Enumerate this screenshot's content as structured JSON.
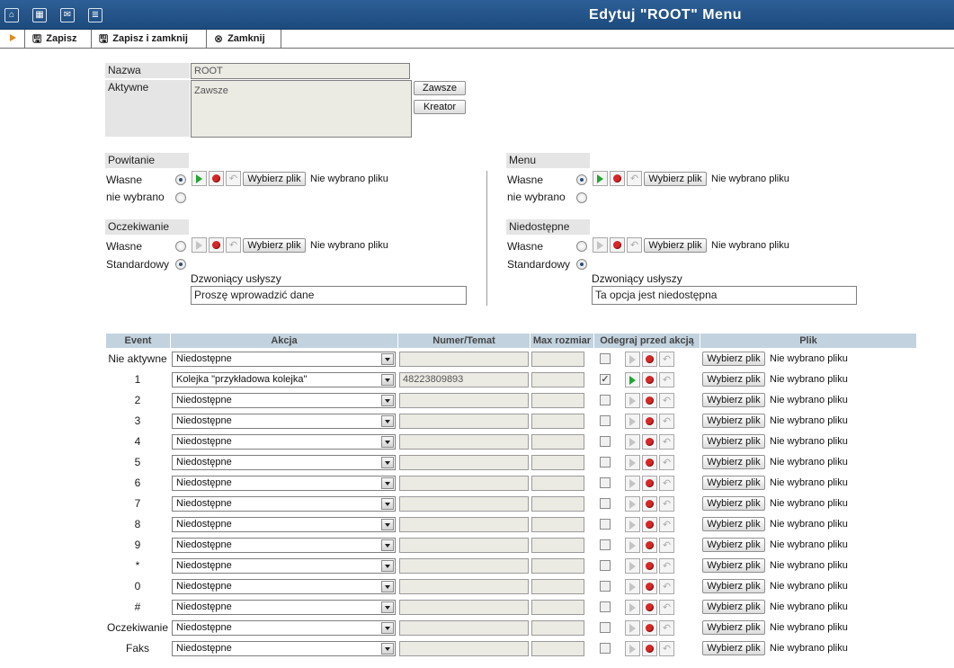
{
  "header": {
    "title": "Edytuj \"ROOT\" Menu"
  },
  "toolbar": {
    "save": "Zapisz",
    "save_close": "Zapisz i zamknij",
    "close": "Zamknij"
  },
  "form": {
    "name_label": "Nazwa",
    "name_value": "ROOT",
    "active_label": "Aktywne",
    "active_value": "Zawsze",
    "btn_always": "Zawsze",
    "btn_wizard": "Kreator"
  },
  "common": {
    "choose_file": "Wybierz plik",
    "no_file": "Nie wybrano pliku"
  },
  "greeting": {
    "title": "Powitanie",
    "own": "Własne",
    "none": "nie wybrano",
    "selected": "own"
  },
  "menu": {
    "title": "Menu",
    "own": "Własne",
    "none": "nie wybrano",
    "selected": "own"
  },
  "waiting": {
    "title": "Oczekiwanie",
    "own": "Własne",
    "standard": "Standardowy",
    "selected": "standard",
    "hears_label": "Dzwoniący usłyszy",
    "hears_value": "Proszę wprowadzić dane"
  },
  "unavailable": {
    "title": "Niedostępne",
    "own": "Własne",
    "standard": "Standardowy",
    "selected": "standard",
    "hears_label": "Dzwoniący usłyszy",
    "hears_value": "Ta opcja jest niedostępna"
  },
  "table": {
    "headers": [
      "Event",
      "Akcja",
      "Numer/Temat",
      "Max rozmiar",
      "Odegraj przed akcją",
      "Plik"
    ],
    "rows": [
      {
        "event": "Nie aktywne",
        "action": "Niedostępne",
        "number": "",
        "play_checked": false,
        "play_enabled": false
      },
      {
        "event": "1",
        "action": "Kolejka \"przykładowa kolejka\"",
        "number": "48223809893",
        "play_checked": true,
        "play_enabled": true
      },
      {
        "event": "2",
        "action": "Niedostępne",
        "number": "",
        "play_checked": false,
        "play_enabled": false
      },
      {
        "event": "3",
        "action": "Niedostępne",
        "number": "",
        "play_checked": false,
        "play_enabled": false
      },
      {
        "event": "4",
        "action": "Niedostępne",
        "number": "",
        "play_checked": false,
        "play_enabled": false
      },
      {
        "event": "5",
        "action": "Niedostępne",
        "number": "",
        "play_checked": false,
        "play_enabled": false
      },
      {
        "event": "6",
        "action": "Niedostępne",
        "number": "",
        "play_checked": false,
        "play_enabled": false
      },
      {
        "event": "7",
        "action": "Niedostępne",
        "number": "",
        "play_checked": false,
        "play_enabled": false
      },
      {
        "event": "8",
        "action": "Niedostępne",
        "number": "",
        "play_checked": false,
        "play_enabled": false
      },
      {
        "event": "9",
        "action": "Niedostępne",
        "number": "",
        "play_checked": false,
        "play_enabled": false
      },
      {
        "event": "*",
        "action": "Niedostępne",
        "number": "",
        "play_checked": false,
        "play_enabled": false
      },
      {
        "event": "0",
        "action": "Niedostępne",
        "number": "",
        "play_checked": false,
        "play_enabled": false
      },
      {
        "event": "#",
        "action": "Niedostępne",
        "number": "",
        "play_checked": false,
        "play_enabled": false
      },
      {
        "event": "Oczekiwanie",
        "action": "Niedostępne",
        "number": "",
        "play_checked": false,
        "play_enabled": false
      },
      {
        "event": "Faks",
        "action": "Niedostępne",
        "number": "",
        "play_checked": false,
        "play_enabled": false
      }
    ]
  }
}
